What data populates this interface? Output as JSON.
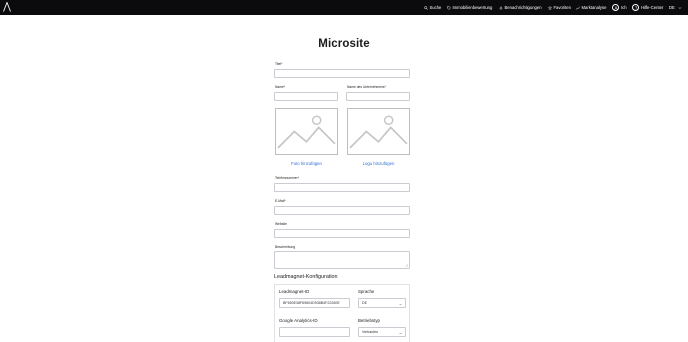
{
  "header": {
    "logo_icon": "brand-a-logo-icon",
    "nav": [
      {
        "label": "Suche",
        "icon": "search-icon"
      },
      {
        "label": "Immobilienbewertung",
        "icon": "tag-icon"
      },
      {
        "label": "Benachrichtigungen",
        "icon": "bell-icon"
      },
      {
        "label": "Favoriten",
        "icon": "star-icon"
      },
      {
        "label": "Marktanalyse",
        "icon": "chart-icon"
      }
    ],
    "user_label": "Ich",
    "help_label": "Hilfe-Center",
    "language": "DE"
  },
  "page": {
    "title": "Microsite"
  },
  "form": {
    "title_label": "Titel*",
    "name_label": "Name*",
    "company_label": "Name des Unternehmens*",
    "photo_button": "Foto hinzufügen",
    "logo_button": "Logo hinzufügen",
    "phone_label": "Telefonnummer*",
    "email_label": "E-Mail*",
    "website_label": "Website",
    "description_label": "Beschreibung"
  },
  "leadmagnet": {
    "section_title": "Leadmagnet-Konfiguration",
    "id_label": "Leadmagnet-ID",
    "id_value": "BF650E38F69604D938B4F22260E",
    "language_label": "Sprache",
    "language_value": "DE",
    "analytics_label": "Google Analytics-ID",
    "analytics_value": "",
    "business_type_label": "Betriebstyp",
    "business_type_value": "Verkaufen"
  },
  "colors": {
    "topbar": "#0b0b0d",
    "link": "#2d6fd8",
    "border": "#c9ccd3"
  }
}
